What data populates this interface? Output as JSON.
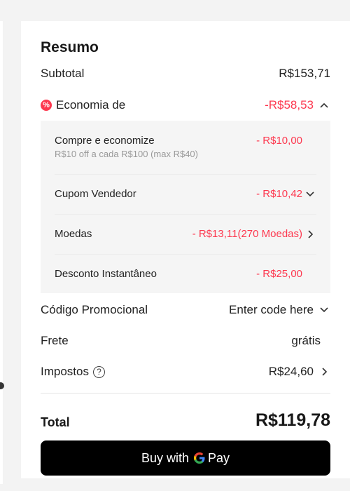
{
  "summary": {
    "title": "Resumo",
    "subtotal_label": "Subtotal",
    "subtotal_value": "R$153,71",
    "savings_label": "Economia de",
    "savings_value": "-R$58,53",
    "savings_icon": "discount-badge-icon",
    "savings_expanded": true
  },
  "discounts": [
    {
      "label": "Compre e economize",
      "hint": "R$10 off a cada R$100 (max R$40)",
      "value": "- R$10,00",
      "chevron": "none"
    },
    {
      "label": "Cupom Vendedor",
      "value": "- R$10,42",
      "chevron": "chevron-down-icon"
    },
    {
      "label": "Moedas",
      "value": "- R$13,11(270 Moedas)",
      "chevron": "chevron-right-icon"
    },
    {
      "label": "Desconto Instantâneo",
      "value": "- R$25,00",
      "chevron": "none"
    }
  ],
  "promo": {
    "label": "Código Promocional",
    "placeholder": "Enter code here"
  },
  "shipping": {
    "label": "Frete",
    "value": "grátis"
  },
  "taxes": {
    "label": "Impostos",
    "help_icon": "?",
    "value": "R$24,60"
  },
  "total": {
    "label": "Total",
    "value": "R$119,78"
  },
  "pay_button": {
    "label_prefix": "Buy with",
    "label_suffix": "Pay"
  },
  "colors": {
    "accent_red": "#fd384f",
    "button_bg": "#000000"
  }
}
